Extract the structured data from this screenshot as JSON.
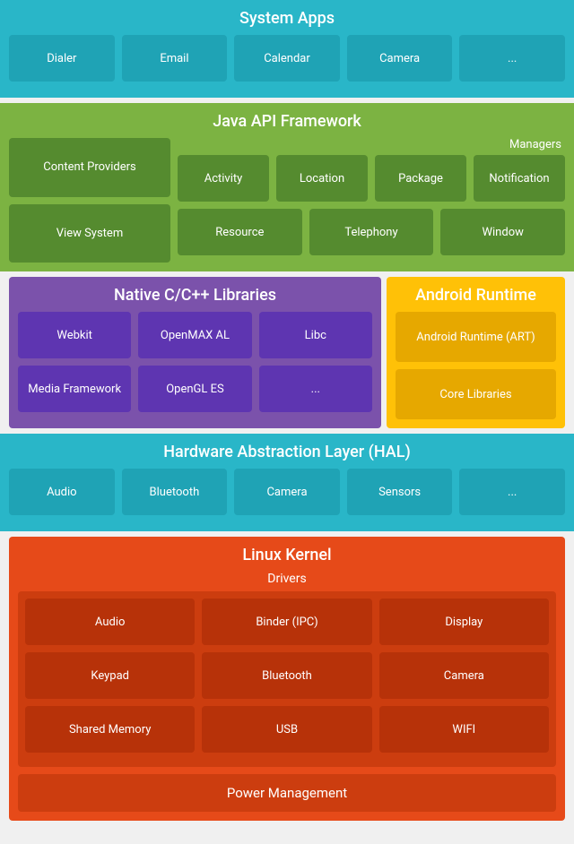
{
  "system_apps": {
    "title": "System Apps",
    "items": [
      "Dialer",
      "Email",
      "Calendar",
      "Camera",
      "..."
    ]
  },
  "java_api": {
    "title": "Java API Framework",
    "managers_label": "Managers",
    "content_providers": "Content Providers",
    "view_system": "View System",
    "managers_row1": [
      "Activity",
      "Location",
      "Package",
      "Notification"
    ],
    "managers_row2": [
      "Resource",
      "Telephony",
      "Window"
    ]
  },
  "native_libs": {
    "title": "Native C/C++ Libraries",
    "row1": [
      "Webkit",
      "OpenMAX AL",
      "Libc"
    ],
    "row2": [
      "Media Framework",
      "OpenGL ES",
      "..."
    ]
  },
  "android_runtime": {
    "title": "Android Runtime",
    "items": [
      "Android Runtime (ART)",
      "Core Libraries"
    ]
  },
  "hal": {
    "title": "Hardware Abstraction Layer (HAL)",
    "items": [
      "Audio",
      "Bluetooth",
      "Camera",
      "Sensors",
      "..."
    ]
  },
  "linux_kernel": {
    "title": "Linux Kernel",
    "drivers_label": "Drivers",
    "drivers_row1": [
      "Audio",
      "Binder (IPC)",
      "Display"
    ],
    "drivers_row2": [
      "Keypad",
      "Bluetooth",
      "Camera"
    ],
    "drivers_row3": [
      "Shared Memory",
      "USB",
      "WIFI"
    ],
    "power_management": "Power Management"
  }
}
